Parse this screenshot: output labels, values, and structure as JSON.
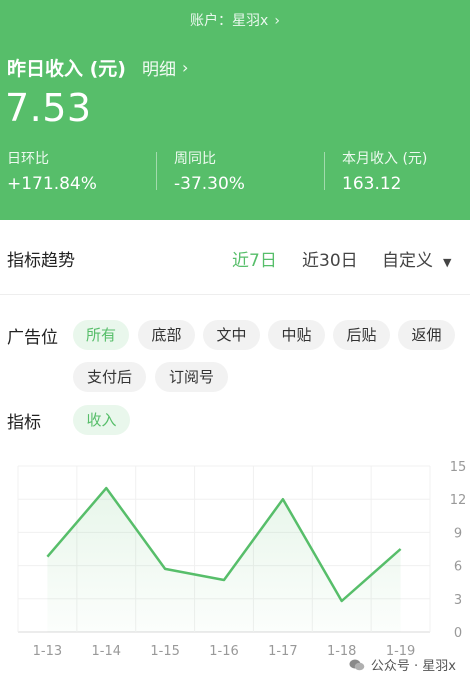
{
  "header": {
    "account_label": "账户：星羽x",
    "title": "昨日收入 (元)",
    "detail_label": "明细",
    "value": "7.53",
    "stats": [
      {
        "label": "日环比",
        "value": "+171.84%"
      },
      {
        "label": "周同比",
        "value": "-37.30%"
      },
      {
        "label": "本月收入 (元)",
        "value": "163.12"
      }
    ]
  },
  "trend": {
    "title": "指标趋势",
    "ranges": [
      {
        "label": "近7日",
        "active": true
      },
      {
        "label": "近30日",
        "active": false
      },
      {
        "label": "自定义",
        "active": false
      }
    ]
  },
  "filters": {
    "ad_position_label": "广告位",
    "ad_positions": [
      "所有",
      "底部",
      "文中",
      "中贴",
      "后贴",
      "返佣",
      "支付后",
      "订阅号"
    ],
    "metric_label": "指标",
    "metrics": [
      "收入"
    ]
  },
  "chart_data": {
    "type": "area",
    "categories": [
      "1-13",
      "1-14",
      "1-15",
      "1-16",
      "1-17",
      "1-18",
      "1-19"
    ],
    "series": [
      {
        "values": [
          6.8,
          13.0,
          5.7,
          4.7,
          12.0,
          2.8,
          7.5
        ]
      }
    ],
    "yticks": [
      "0",
      "3",
      "6",
      "9",
      "12",
      "15"
    ],
    "ylim": [
      0,
      15
    ],
    "color": "#57be6a",
    "grid": true
  },
  "footer": {
    "watermark": "公众号 · 星羽x"
  },
  "colors": {
    "accent": "#57be6a"
  }
}
